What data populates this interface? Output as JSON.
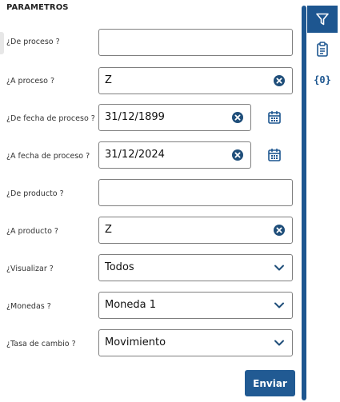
{
  "panel": {
    "title": "PARAMETROS"
  },
  "fields": [
    {
      "label": "¿De proceso ?",
      "value": ""
    },
    {
      "label": "¿A proceso ?",
      "value": "Z"
    },
    {
      "label": "¿De fecha de proceso ?",
      "value": "31/12/1899"
    },
    {
      "label": "¿A fecha de proceso ?",
      "value": "31/12/2024"
    },
    {
      "label": "¿De producto ?",
      "value": ""
    },
    {
      "label": "¿A producto ?",
      "value": "Z"
    },
    {
      "label": "¿Visualizar ?",
      "value": "Todos"
    },
    {
      "label": "¿Monedas ?",
      "value": "Moneda 1"
    },
    {
      "label": "¿Tasa de cambio ?",
      "value": "Movimiento"
    }
  ],
  "submit": {
    "label": "Enviar"
  },
  "side_toolbar": {
    "items": [
      {
        "icon": "filter-icon",
        "active": true
      },
      {
        "icon": "clipboard-icon",
        "active": false
      },
      {
        "icon": "variables-icon",
        "text": "{0}",
        "active": false
      }
    ]
  },
  "colors": {
    "accent": "#1d5690",
    "button": "#215a93",
    "clear_icon": "#1f4e7a"
  }
}
